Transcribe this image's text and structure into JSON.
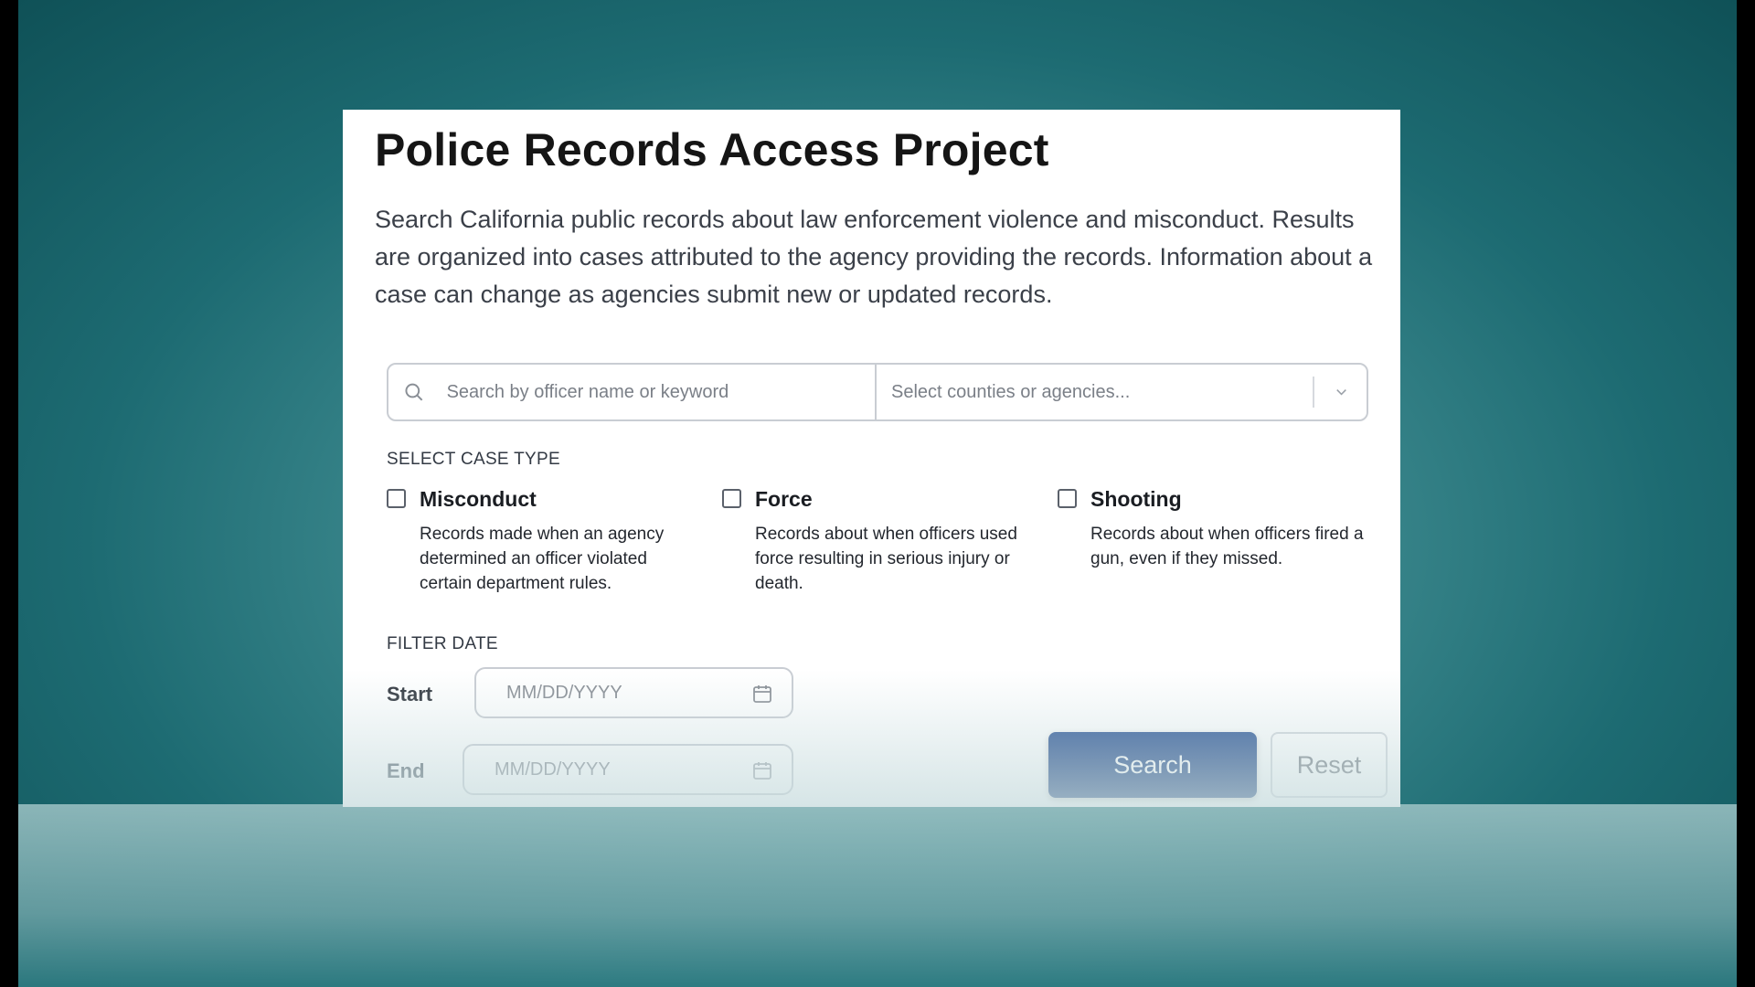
{
  "page": {
    "title": "Police Records Access Project",
    "description": "Search California public records about law enforcement violence and misconduct. Results are organized into cases attributed to the agency providing the records. Information about a case can change as agencies submit new or updated records."
  },
  "search": {
    "keyword_placeholder": "Search by officer name or keyword",
    "agency_placeholder": "Select counties or agencies..."
  },
  "case_type": {
    "label": "SELECT CASE TYPE",
    "options": [
      {
        "name": "Misconduct",
        "description": "Records made when an agency determined an officer violated certain department rules.",
        "checked": false
      },
      {
        "name": "Force",
        "description": "Records about when officers used force resulting in serious injury or death.",
        "checked": false
      },
      {
        "name": "Shooting",
        "description": "Records about when officers fired a gun, even if they missed.",
        "checked": false
      }
    ]
  },
  "filter_date": {
    "label": "FILTER DATE",
    "start_label": "Start",
    "end_label": "End",
    "start_placeholder": "MM/DD/YYYY",
    "end_placeholder": "MM/DD/YYYY"
  },
  "actions": {
    "search_label": "Search",
    "reset_label": "Reset"
  },
  "colors": {
    "background": "#1d6b72",
    "primary_button": "#23467f"
  }
}
